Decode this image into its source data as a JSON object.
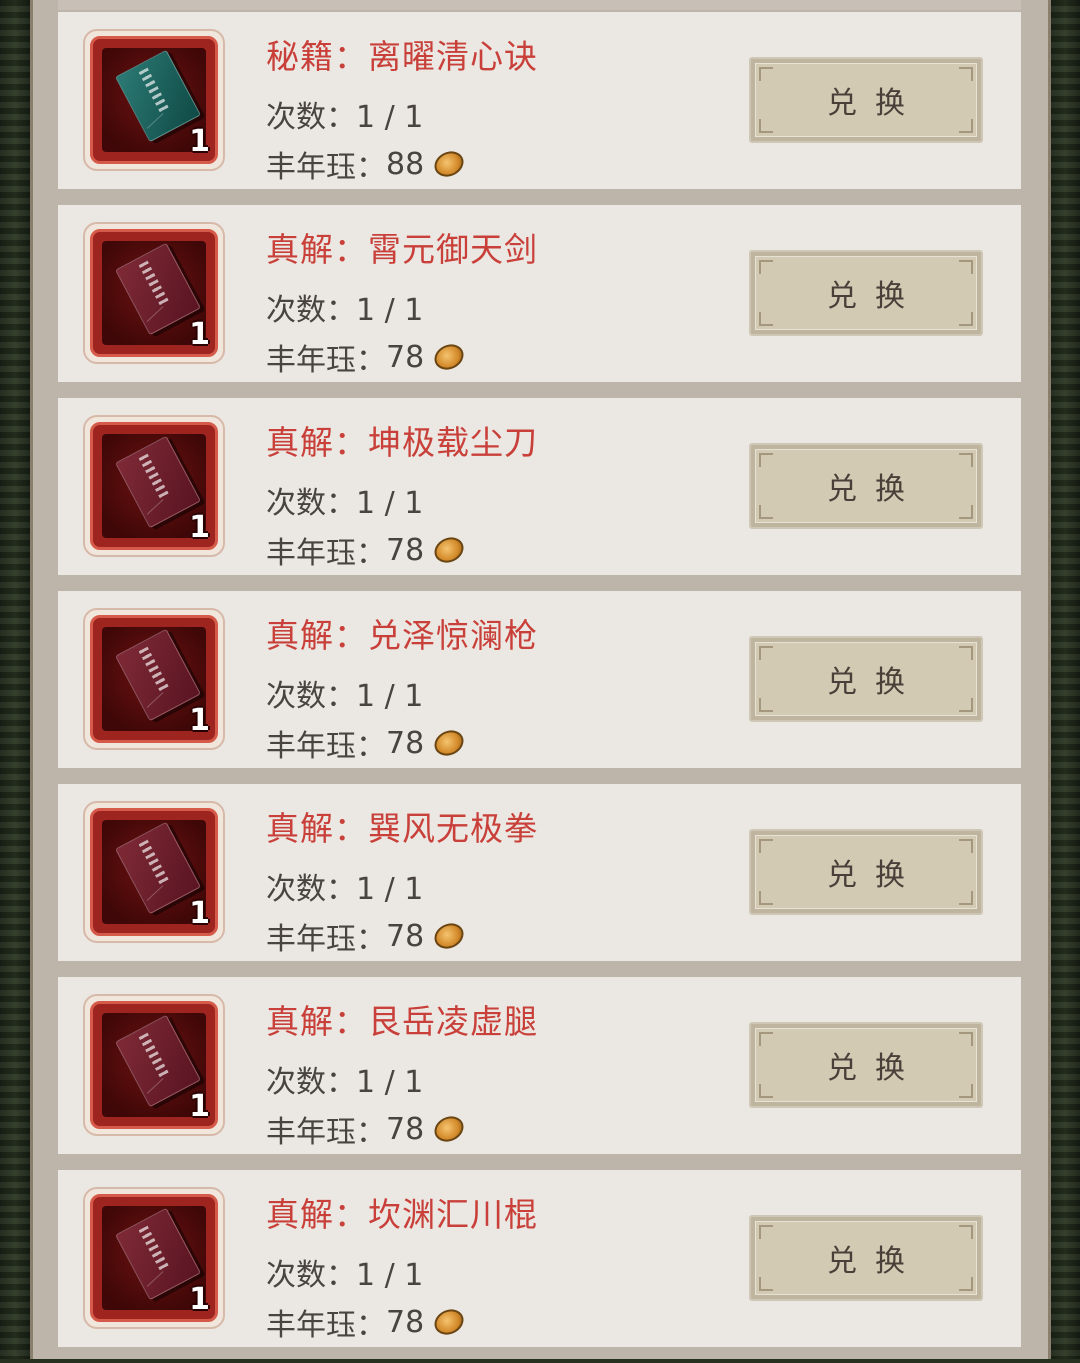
{
  "exchange_list": {
    "items": [
      {
        "title": "秘籍：离曜清心诀",
        "count": "次数：1 / 1",
        "cost_label": "丰年珏：",
        "cost": "88",
        "quantity": "1",
        "book_color": "teal",
        "button": "兑换"
      },
      {
        "title": "真解：霄元御天剑",
        "count": "次数：1 / 1",
        "cost_label": "丰年珏：",
        "cost": "78",
        "quantity": "1",
        "book_color": "red",
        "button": "兑换"
      },
      {
        "title": "真解：坤极载尘刀",
        "count": "次数：1 / 1",
        "cost_label": "丰年珏：",
        "cost": "78",
        "quantity": "1",
        "book_color": "red",
        "button": "兑换"
      },
      {
        "title": "真解：兑泽惊澜枪",
        "count": "次数：1 / 1",
        "cost_label": "丰年珏：",
        "cost": "78",
        "quantity": "1",
        "book_color": "red",
        "button": "兑换"
      },
      {
        "title": "真解：巽风无极拳",
        "count": "次数：1 / 1",
        "cost_label": "丰年珏：",
        "cost": "78",
        "quantity": "1",
        "book_color": "red",
        "button": "兑换"
      },
      {
        "title": "真解：艮岳凌虚腿",
        "count": "次数：1 / 1",
        "cost_label": "丰年珏：",
        "cost": "78",
        "quantity": "1",
        "book_color": "red",
        "button": "兑换"
      },
      {
        "title": "真解：坎渊汇川棍",
        "count": "次数：1 / 1",
        "cost_label": "丰年珏：",
        "cost": "78",
        "quantity": "1",
        "book_color": "red",
        "button": "兑换"
      }
    ]
  },
  "colors": {
    "title_red": "#c9403a",
    "row_bg": "#ebe7e2",
    "button_bg": "#d2cab3",
    "icon_frame_red": "#9d241f"
  },
  "icons": {
    "currency": "jade-coin-icon",
    "item": "book-icon"
  }
}
